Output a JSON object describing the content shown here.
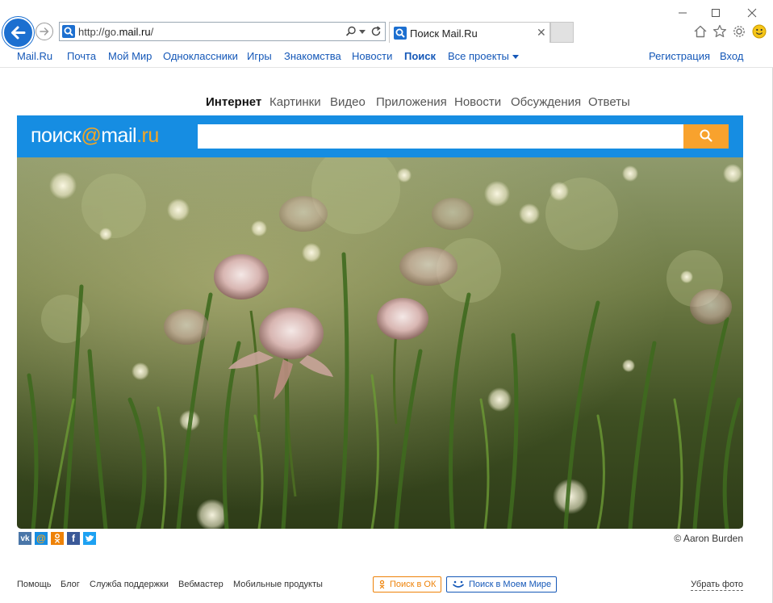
{
  "browser": {
    "address": {
      "prefix": "http://go.",
      "domain": "mail.ru",
      "suffix": "/"
    },
    "tab_title": "Поиск Mail.Ru"
  },
  "topnav": {
    "left": [
      "Mail.Ru",
      "Почта",
      "Мой Мир",
      "Одноклассники",
      "Игры",
      "Знакомства",
      "Новости",
      "Поиск",
      "Все проекты"
    ],
    "right": [
      "Регистрация",
      "Вход"
    ]
  },
  "vertical_tabs": [
    "Интернет",
    "Картинки",
    "Видео",
    "Приложения",
    "Новости",
    "Обсуждения",
    "Ответы"
  ],
  "search": {
    "logo": {
      "main": "поиск",
      "at": "@",
      "domain": "mail",
      "tld": ".ru"
    },
    "query": ""
  },
  "photo_credit": "© Aaron Burden",
  "social_icons": [
    "vk-icon",
    "mail-icon",
    "odnoklassniki-icon",
    "facebook-icon",
    "twitter-icon"
  ],
  "footer": {
    "links": [
      "Помощь",
      "Блог",
      "Служба поддержки",
      "Вебмастер",
      "Мобильные продукты"
    ],
    "ok_button": "Поиск в ОК",
    "mymir_button": "Поиск в Моем Мире",
    "remove_photo": "Убрать фото"
  },
  "colors": {
    "link": "#1558b8",
    "search_panel": "#168de2",
    "search_button": "#f8a22d",
    "ok_orange": "#ee8208"
  }
}
